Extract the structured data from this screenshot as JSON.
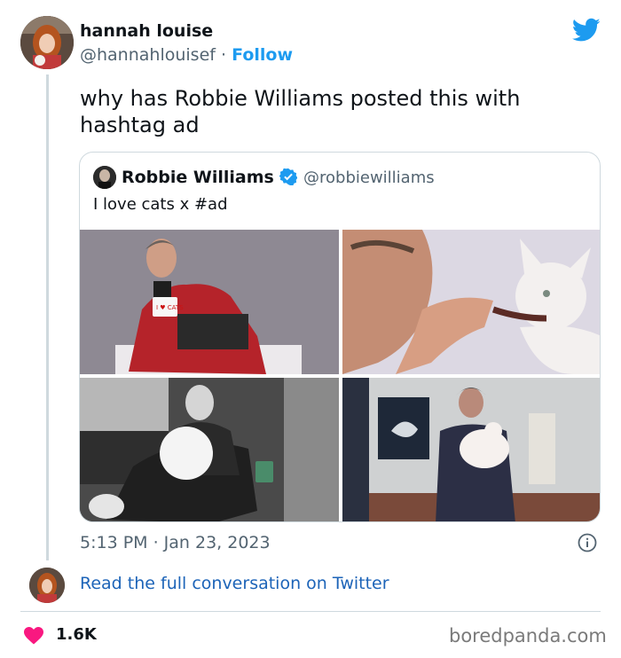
{
  "author": {
    "name": "hannah louise",
    "handle": "@hannahlouisef",
    "separator": "·",
    "follow_label": "Follow"
  },
  "tweet": {
    "text": "why has Robbie Williams posted this with hashtag ad"
  },
  "quoted": {
    "name": "Robbie Williams",
    "handle": "@robbiewilliams",
    "text": "I love cats x #ad",
    "mug_text": "I ♥ CATS"
  },
  "meta": {
    "timestamp": "5:13 PM · Jan 23, 2023"
  },
  "footer": {
    "read_link": "Read the full conversation on Twitter",
    "likes": "1.6K",
    "watermark": "boredpanda.com"
  },
  "colors": {
    "twitter_blue": "#1d9bf0",
    "link_blue": "#1d64b8",
    "heart_red": "#f91880",
    "text_gray": "#536471"
  },
  "icons": [
    "twitter-bird-icon",
    "verified-badge-icon",
    "info-icon",
    "heart-icon"
  ]
}
